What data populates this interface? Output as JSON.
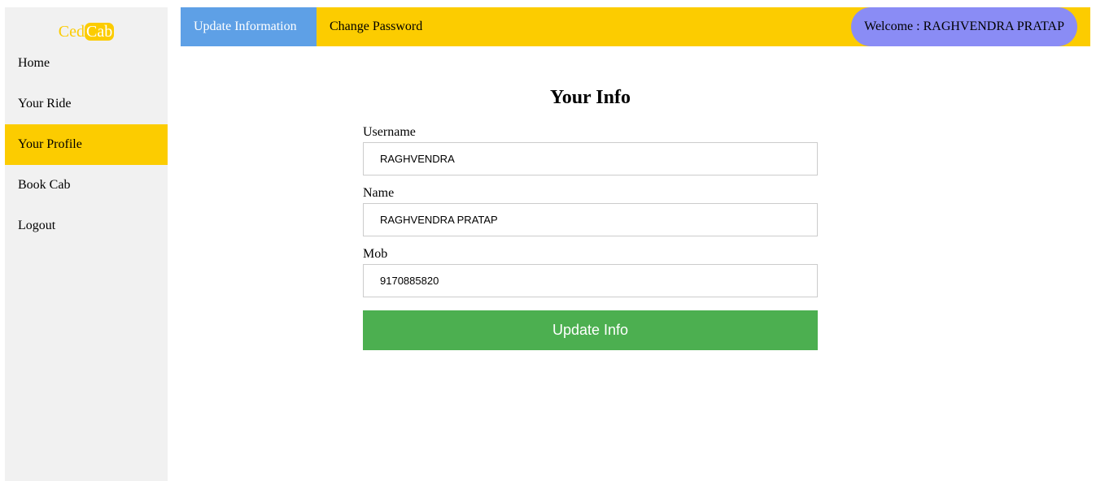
{
  "brand": {
    "logo_part1": "Ced",
    "logo_part2": "Cab",
    "primary_color": "#fccc00"
  },
  "sidebar": {
    "items": [
      {
        "label": "Home",
        "active": false
      },
      {
        "label": "Your Ride",
        "active": false
      },
      {
        "label": "Your Profile",
        "active": true
      },
      {
        "label": "Book Cab",
        "active": false
      },
      {
        "label": "Logout",
        "active": false
      }
    ]
  },
  "topbar": {
    "tabs": [
      {
        "label": "Update Information",
        "active": true
      },
      {
        "label": "Change Password",
        "active": false
      }
    ],
    "welcome": "Welcome : RAGHVENDRA PRATAP"
  },
  "form": {
    "title": "Your Info",
    "fields": [
      {
        "label": "Username",
        "value": "RAGHVENDRA"
      },
      {
        "label": "Name",
        "value": "RAGHVENDRA PRATAP"
      },
      {
        "label": "Mob",
        "value": "9170885820"
      }
    ],
    "submit_label": "Update Info",
    "submit_color": "#4caf50"
  }
}
